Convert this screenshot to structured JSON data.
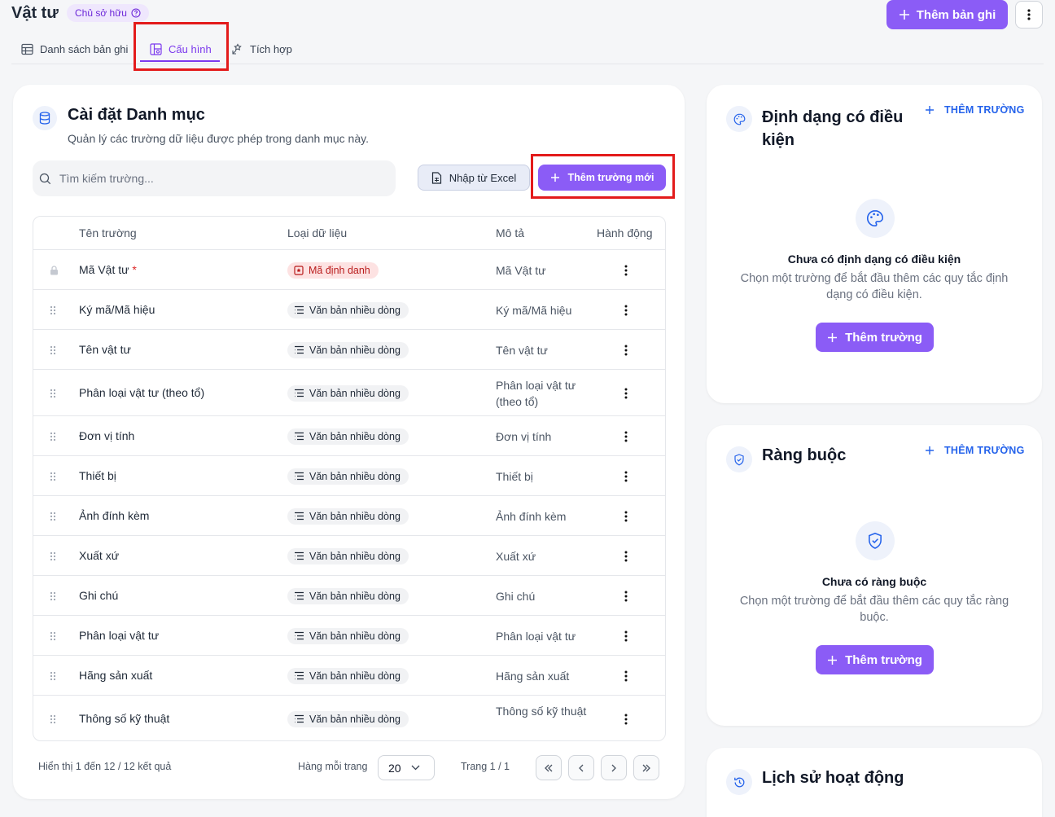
{
  "header": {
    "title": "Vật tư",
    "owner_badge": "Chủ sở hữu",
    "add_record_label": "Thêm bản ghi"
  },
  "tabs": [
    {
      "label": "Danh sách bản ghi",
      "icon": "table-icon"
    },
    {
      "label": "Cấu hình",
      "icon": "layout-config-icon",
      "active": true
    },
    {
      "label": "Tích hợp",
      "icon": "integration-icon"
    }
  ],
  "catalog": {
    "title": "Cài đặt Danh mục",
    "subtitle": "Quản lý các trường dữ liệu được phép trong danh mục này.",
    "search_placeholder": "Tìm kiếm trường...",
    "import_label": "Nhập từ Excel",
    "new_field_label": "Thêm trường mới",
    "columns": [
      "Tên trường",
      "Loại dữ liệu",
      "Mô tả",
      "Hành động"
    ],
    "rows": [
      {
        "name": "Mã Vật tư",
        "required": "*",
        "type": "Mã định danh",
        "desc": "Mã Vật tư",
        "locked": true
      },
      {
        "name": "Ký mã/Mã hiệu",
        "type": "Văn bản nhiều dòng",
        "desc": "Ký mã/Mã hiệu"
      },
      {
        "name": "Tên vật tư",
        "type": "Văn bản nhiều dòng",
        "desc": "Tên vật tư"
      },
      {
        "name": "Phân loại vật tư (theo tổ)",
        "type": "Văn bản nhiều dòng",
        "desc": "Phân loại vật tư (theo tổ)"
      },
      {
        "name": "Đơn vị tính",
        "type": "Văn bản nhiều dòng",
        "desc": "Đơn vị tính"
      },
      {
        "name": "Thiết bị",
        "type": "Văn bản nhiều dòng",
        "desc": "Thiết bị"
      },
      {
        "name": "Ảnh đính kèm",
        "type": "Văn bản nhiều dòng",
        "desc": "Ảnh đính kèm"
      },
      {
        "name": "Xuất xứ",
        "type": "Văn bản nhiều dòng",
        "desc": "Xuất xứ"
      },
      {
        "name": "Ghi chú",
        "type": "Văn bản nhiều dòng",
        "desc": "Ghi chú"
      },
      {
        "name": "Phân loại vật tư",
        "type": "Văn bản nhiều dòng",
        "desc": "Phân loại vật tư"
      },
      {
        "name": "Hãng sản xuất",
        "type": "Văn bản nhiều dòng",
        "desc": "Hãng sản xuất"
      },
      {
        "name": "Thông số kỹ thuật",
        "type": "Văn bản nhiều dòng",
        "desc": "Thông số kỹ thuật"
      }
    ],
    "footer": {
      "showing": "Hiển thị 1 đến 12 / 12 kết quả",
      "rows_per_page_label": "Hàng mỗi trang",
      "rows_per_page_value": "20",
      "page_info": "Trang 1 / 1"
    }
  },
  "conditional_format": {
    "title": "Định dạng có điều kiện",
    "add_label": "THÊM TRƯỜNG",
    "empty_title": "Chưa có định dạng có điều kiện",
    "empty_sub": "Chọn một trường để bắt đầu thêm các quy tắc định dạng có điều kiện.",
    "button_label": "Thêm trường"
  },
  "constraints": {
    "title": "Ràng buộc",
    "add_label": "THÊM TRƯỜNG",
    "empty_title": "Chưa có ràng buộc",
    "empty_sub": "Chọn một trường để bắt đầu thêm các quy tắc ràng buộc.",
    "button_label": "Thêm trường"
  },
  "history": {
    "title": "Lịch sử hoạt động"
  },
  "colors": {
    "accent": "#8b5cf6",
    "link": "#2563eb",
    "highlight_box": "#e31b1b"
  }
}
